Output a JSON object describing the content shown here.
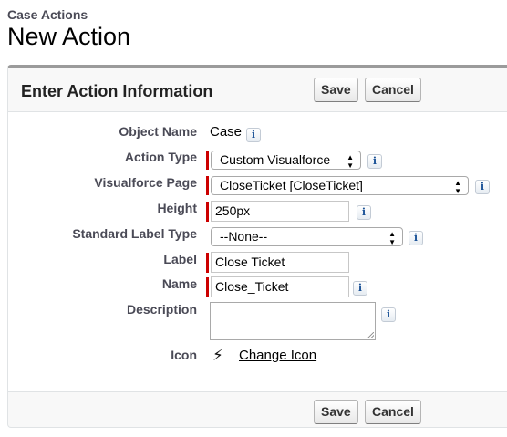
{
  "header": {
    "breadcrumb": "Case Actions",
    "title": "New Action"
  },
  "panel": {
    "title": "Enter Action Information",
    "save_label": "Save",
    "cancel_label": "Cancel",
    "info_glyph": "i"
  },
  "fields": {
    "object_name": {
      "label": "Object Name",
      "value": "Case"
    },
    "action_type": {
      "label": "Action Type",
      "value": "Custom Visualforce"
    },
    "visualforce_page": {
      "label": "Visualforce Page",
      "value": "CloseTicket [CloseTicket]"
    },
    "height": {
      "label": "Height",
      "value": "250px"
    },
    "standard_label_type": {
      "label": "Standard Label Type",
      "value": "--None--"
    },
    "label": {
      "label": "Label",
      "value": "Close Ticket"
    },
    "name": {
      "label": "Name",
      "value": "Close_Ticket"
    },
    "description": {
      "label": "Description",
      "value": ""
    },
    "icon": {
      "label": "Icon",
      "link": "Change Icon",
      "icon_name": "lightning-bolt-icon"
    }
  },
  "icons": {
    "select_arrows": "▲▼",
    "bolt": "⚡"
  },
  "colors": {
    "required_marker": "#cc0000",
    "panel_top_border": "#9b9b9b",
    "label_text": "#4a4a56"
  }
}
